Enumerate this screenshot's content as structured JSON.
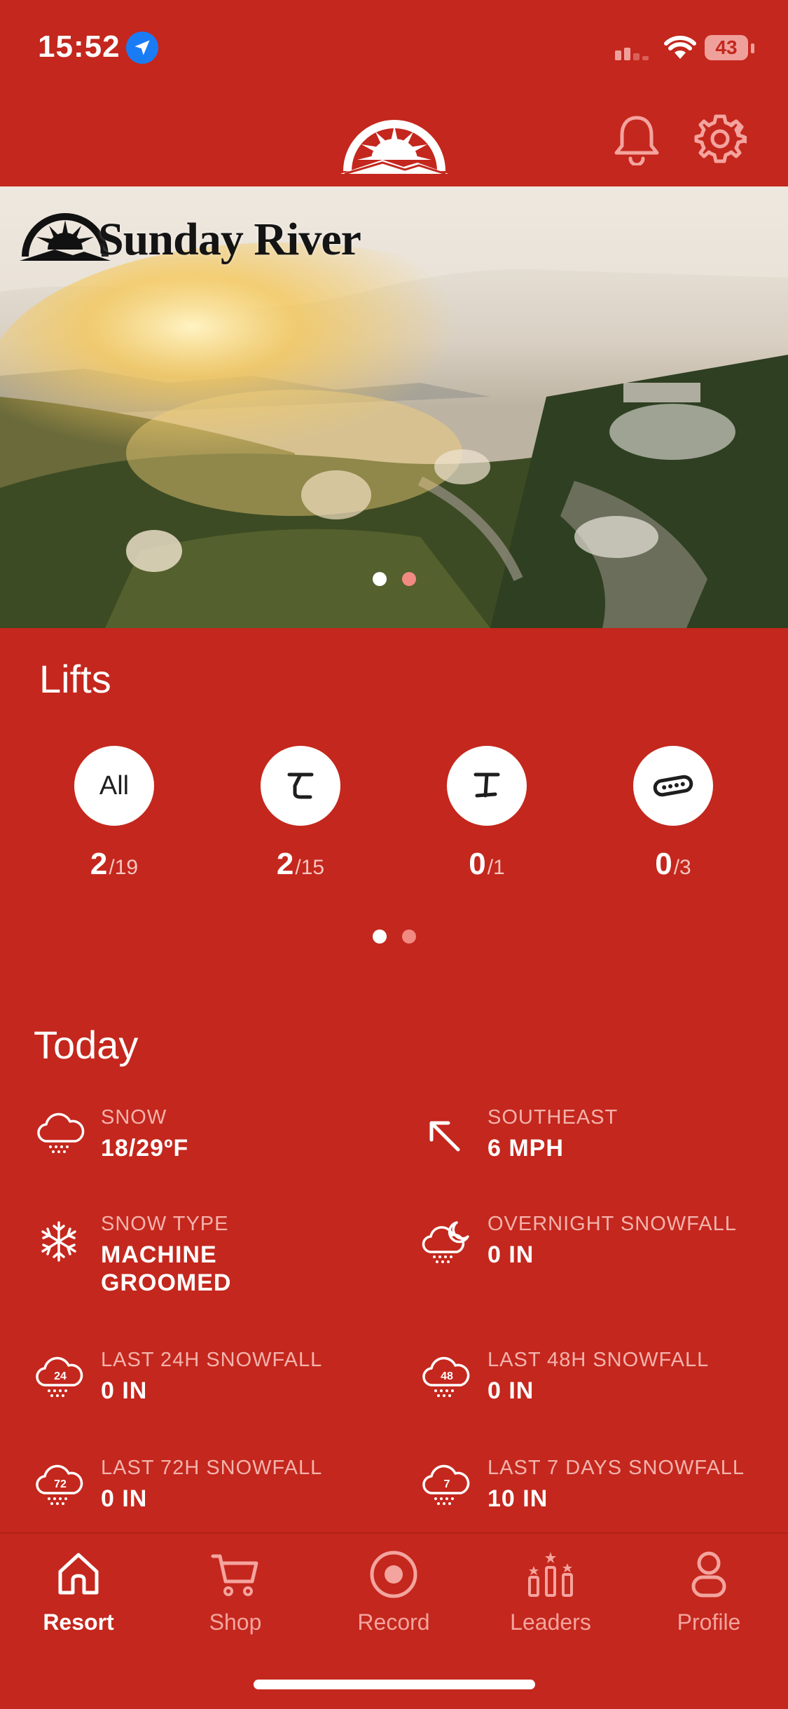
{
  "status_bar": {
    "time": "15:52",
    "battery": "43"
  },
  "hero": {
    "brand": "Sunday River",
    "pages": 2,
    "active_page": 0
  },
  "lifts": {
    "title": "Lifts",
    "items": [
      {
        "icon": "all-label",
        "label": "All",
        "open": "2",
        "total": "/19"
      },
      {
        "icon": "chairlift-icon",
        "open": "2",
        "total": "/15"
      },
      {
        "icon": "t-bar-icon",
        "open": "0",
        "total": "/1"
      },
      {
        "icon": "gondola-icon",
        "open": "0",
        "total": "/3"
      }
    ],
    "pages": 2,
    "active_page": 0
  },
  "today": {
    "title": "Today",
    "items": [
      {
        "icon": "snow-cloud-icon",
        "label": "SNOW",
        "value": "18/29ºF"
      },
      {
        "icon": "wind-direction-icon",
        "label": "SOUTHEAST",
        "value": "6 MPH"
      },
      {
        "icon": "snowflake-icon",
        "label": "SNOW TYPE",
        "value_line1": "MACHINE",
        "value_line2": "GROOMED"
      },
      {
        "icon": "night-snow-icon",
        "label": "OVERNIGHT SNOWFALL",
        "value": "0 IN"
      },
      {
        "icon": "snow-24h-icon",
        "badge": "24",
        "label": "LAST 24H SNOWFALL",
        "value": "0 IN"
      },
      {
        "icon": "snow-48h-icon",
        "badge": "48",
        "label": "LAST 48H SNOWFALL",
        "value": "0 IN"
      },
      {
        "icon": "snow-72h-icon",
        "badge": "72",
        "label": "LAST 72H SNOWFALL",
        "value": "0 IN"
      },
      {
        "icon": "snow-7d-icon",
        "badge": "7",
        "label": "LAST 7 DAYS SNOWFALL",
        "value": "10 IN"
      }
    ]
  },
  "tabs": [
    {
      "icon": "home-icon",
      "label": "Resort",
      "active": true
    },
    {
      "icon": "cart-icon",
      "label": "Shop",
      "active": false
    },
    {
      "icon": "record-icon",
      "label": "Record",
      "active": false
    },
    {
      "icon": "leaders-icon",
      "label": "Leaders",
      "active": false
    },
    {
      "icon": "profile-icon",
      "label": "Profile",
      "active": false
    }
  ],
  "colors": {
    "background": "#c4271d",
    "accent_light": "#f4a49e",
    "dot_inactive": "#f08a82",
    "location_blue": "#1a7cf5"
  }
}
